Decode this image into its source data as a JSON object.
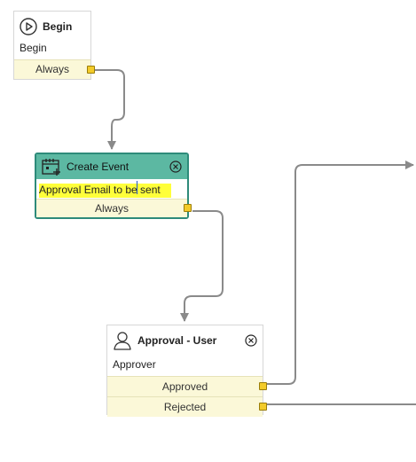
{
  "nodes": {
    "begin": {
      "icon": "play-circle-icon",
      "title": "Begin",
      "subtitle": "Begin",
      "outcome": "Always"
    },
    "create_event": {
      "icon": "calendar-add-icon",
      "title": "Create Event",
      "subtitle": "Approval Email to be sent",
      "outcome": "Always",
      "close_icon": "close-circle-icon",
      "header_color": "#5cb8a2",
      "border_color": "#2e8b7a",
      "highlight_color": "#ffff3a"
    },
    "approval": {
      "icon": "user-outline-icon",
      "title": "Approval - User",
      "subtitle": "Approver",
      "outcomes": [
        "Approved",
        "Rejected"
      ],
      "close_icon": "close-circle-icon"
    }
  },
  "colors": {
    "outcome_bg": "#fbf8d8",
    "port": "#f3cb2a",
    "connector": "#8a8a8a"
  }
}
